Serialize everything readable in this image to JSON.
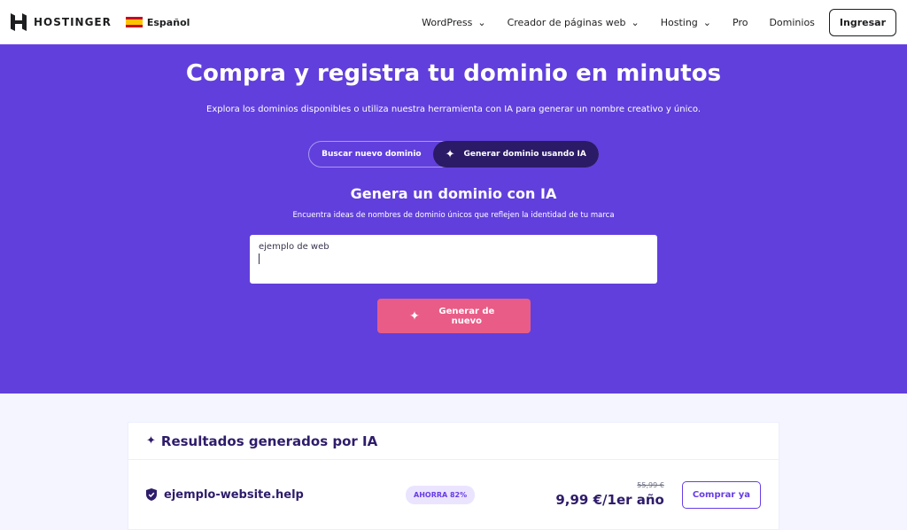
{
  "header": {
    "brand": "HOSTINGER",
    "language": "Español",
    "menu": [
      {
        "label": "WordPress",
        "dropdown": true
      },
      {
        "label": "Creador de páginas web",
        "dropdown": true
      },
      {
        "label": "Hosting",
        "dropdown": true
      },
      {
        "label": "Pro",
        "dropdown": false
      },
      {
        "label": "Dominios",
        "dropdown": false
      }
    ],
    "login": "Ingresar"
  },
  "hero": {
    "title": "Compra y registra tu dominio en minutos",
    "subtitle": "Explora los dominios disponibles o utiliza nuestra herramienta con IA para generar un nombre creativo y único.",
    "tabs": [
      {
        "label": "Buscar nuevo dominio",
        "active": false
      },
      {
        "label": "Generar dominio usando IA",
        "active": true,
        "icon": "sparkles-icon"
      }
    ],
    "ai_title": "Genera un dominio con IA",
    "ai_subtitle": "Encuentra ideas de nombres de dominio únicos que reflejen la identidad de tu marca",
    "input_value": "ejemplo de web",
    "generate_label": "Generar de nuevo"
  },
  "results": {
    "title": "Resultados generados por IA",
    "items": [
      {
        "domain": "ejemplo-website.help",
        "badge": "AHORRA 82%",
        "old_price": "55,99 €",
        "price": "9,99 €/1er año",
        "button": "Comprar ya"
      }
    ]
  },
  "colors": {
    "primary": "#673de6",
    "hero_bg": "#613fdc",
    "active_tab": "#2b1a66",
    "generate_button": "#e95c87",
    "text_dark": "#2f1c6a"
  }
}
